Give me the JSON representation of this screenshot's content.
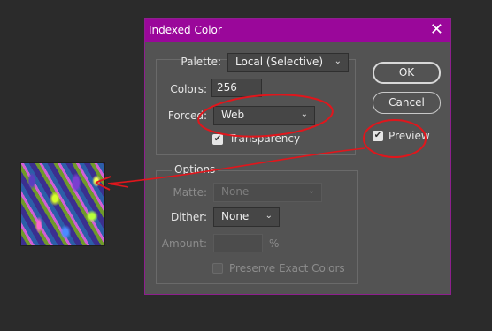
{
  "dialog": {
    "title": "Indexed Color",
    "close_glyph": "✕"
  },
  "palette": {
    "label": "Palette:",
    "value": "Local (Selective)"
  },
  "colors": {
    "label": "Colors:",
    "value": "256"
  },
  "forced": {
    "label": "Forced:",
    "value": "Web"
  },
  "transparency": {
    "label": "Transparency",
    "checked": true
  },
  "options": {
    "title": "Options",
    "matte": {
      "label": "Matte:",
      "value": "None"
    },
    "dither": {
      "label": "Dither:",
      "value": "None"
    },
    "amount": {
      "label": "Amount:",
      "value": "",
      "unit": "%"
    },
    "preserve": {
      "label": "Preserve Exact Colors",
      "checked": false
    }
  },
  "buttons": {
    "ok": "OK",
    "cancel": "Cancel"
  },
  "preview": {
    "label": "Preview",
    "checked": true
  },
  "icons": {
    "check": "checkmark-icon",
    "chevron": "chevron-down-icon",
    "close": "close-icon"
  },
  "colors_theme": {
    "titlebar": "#9a079a",
    "annotation": "#e0161c",
    "dialog_bg": "#535353"
  }
}
